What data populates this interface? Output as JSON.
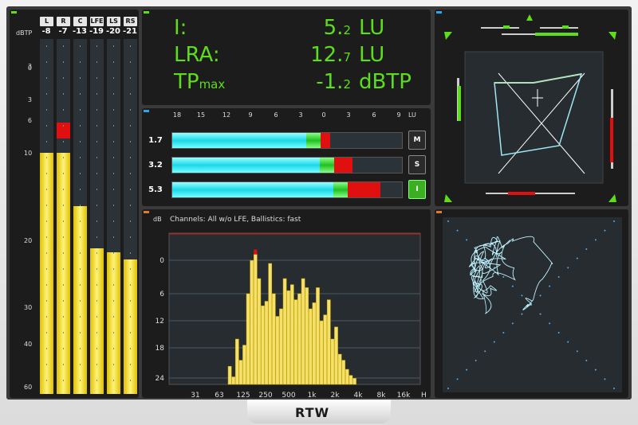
{
  "ppm": {
    "unit": "dBTP",
    "channels": [
      {
        "label": "L",
        "value": "-8",
        "level": 0.68,
        "peak": 0.0
      },
      {
        "label": "R",
        "value": "-7",
        "level": 0.68,
        "peak": 0.72
      },
      {
        "label": "C",
        "value": "-13",
        "level": 0.53,
        "peak": 0.0
      },
      {
        "label": "LFE",
        "value": "-19",
        "level": 0.41,
        "peak": 0.0
      },
      {
        "label": "LS",
        "value": "-20",
        "level": 0.4,
        "peak": 0.0
      },
      {
        "label": "RS",
        "value": "-21",
        "level": 0.38,
        "peak": 0.0
      }
    ],
    "scale": [
      "3",
      "0",
      "3",
      "6",
      "10",
      "20",
      "30",
      "40",
      "60"
    ]
  },
  "loudness": {
    "rows": [
      {
        "label": "I:",
        "label_sub": "",
        "value_main": "5.",
        "value_frac": "2",
        "unit": "LU"
      },
      {
        "label": "LRA:",
        "label_sub": "",
        "value_main": "12.",
        "value_frac": "7",
        "unit": "LU"
      },
      {
        "label": "TP",
        "label_sub": "max",
        "value_main": "-1.",
        "value_frac": "2",
        "unit": "dBTP"
      }
    ]
  },
  "bargraph": {
    "scale": [
      "18",
      "15",
      "12",
      "9",
      "6",
      "3",
      "0",
      "3",
      "6",
      "9"
    ],
    "unit": "LU",
    "rows": [
      {
        "value": "1.7",
        "button": "M",
        "active": false,
        "fill": 0.64,
        "red": 0.04
      },
      {
        "value": "3.2",
        "button": "S",
        "active": false,
        "fill": 0.7,
        "red": 0.08
      },
      {
        "value": "5.3",
        "button": "I",
        "active": true,
        "fill": 0.76,
        "red": 0.14
      }
    ]
  },
  "rta": {
    "caption": "Channels: All w/o LFE, Ballistics: fast",
    "yunit": "dB",
    "yticks": [
      "0",
      "6",
      "12",
      "18",
      "24"
    ],
    "xticks": [
      "31",
      "63",
      "125",
      "250",
      "500",
      "1k",
      "2k",
      "4k",
      "8k",
      "16k"
    ],
    "xunit_trunc": "H",
    "colors": {
      "bar": "#f4e06a",
      "peak": "#e01010",
      "grid": "#4a5a62"
    }
  },
  "logo": "RTW"
}
